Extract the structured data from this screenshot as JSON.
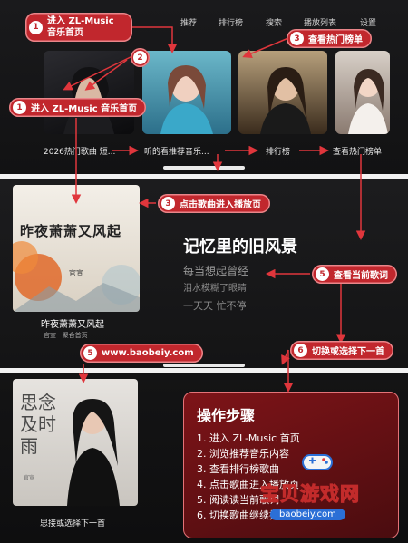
{
  "nav": [
    "推荐",
    "排行榜",
    "搜索",
    "播放列表",
    "设置"
  ],
  "top_cards": [
    {
      "caption": "2026热门歌曲 短..."
    },
    {
      "caption": "听的看推荐音乐..."
    },
    {
      "caption": "排行榜"
    },
    {
      "caption": "查看热门榜单"
    }
  ],
  "badges": {
    "b1a": {
      "num": "1",
      "text": "进入 ZL-Music 音乐首页"
    },
    "b2": {
      "num": "2",
      "text": ""
    },
    "b3a": {
      "num": "3",
      "text": "查看热门榜单"
    },
    "b1b": {
      "num": "1",
      "text": "进入 ZL-Music 音乐首页"
    },
    "b3b": {
      "num": "3",
      "text": "点击歌曲进入播放页"
    },
    "b5": {
      "num": "5",
      "text": "查看当前歌词"
    },
    "b6": {
      "num": "6",
      "text": "切换或选择下一首"
    },
    "b5url": {
      "num": "5",
      "text": "www.baobeiy.com"
    }
  },
  "player": {
    "cover_title": "昨夜萧萧又风起",
    "cover_artist": "官宣",
    "song_title": "昨夜萧萧又风起",
    "song_meta": "官宣 · 聚合首页",
    "lyric_current": "记忆里的旧风景",
    "lyric_next1": "每当想起曾经",
    "lyric_next2": "泪水模糊了眼睛",
    "lyric_next3": "一天天 忙不停"
  },
  "bottom": {
    "cover_text": "思念及时雨",
    "cover_small": "官宣",
    "caption": "思接或选择下一首"
  },
  "steps": {
    "title": "操作步骤",
    "items": [
      "1. 进入 ZL-Music 首页",
      "2. 浏览推荐音乐内容",
      "3. 查看排行榜歌曲",
      "4. 点击歌曲进入播放页",
      "5. 阅读读当前歌词",
      "6. 切换歌曲继续播放"
    ]
  },
  "watermark": {
    "main": "宝贝游戏网",
    "url": "baobeiy.com"
  },
  "colors": {
    "accent": "#c1272d",
    "arrow": "#e0363c",
    "bg": "#141415"
  }
}
